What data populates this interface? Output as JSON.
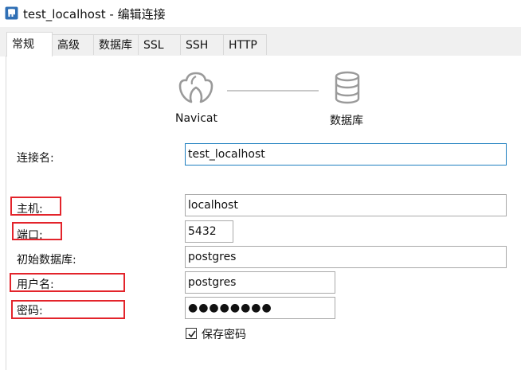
{
  "window": {
    "title": "test_localhost - 编辑连接",
    "icon": "elephant-app-icon"
  },
  "tabs": [
    {
      "label": "常规",
      "active": true
    },
    {
      "label": "高级",
      "active": false
    },
    {
      "label": "数据库",
      "active": false
    },
    {
      "label": "SSL",
      "active": false
    },
    {
      "label": "SSH",
      "active": false
    },
    {
      "label": "HTTP",
      "active": false
    }
  ],
  "graphic": {
    "left_caption": "Navicat",
    "right_caption": "数据库",
    "left_icon": "navicat-logo-icon",
    "right_icon": "database-icon"
  },
  "form": {
    "connection_name": {
      "label": "连接名:",
      "value": "test_localhost"
    },
    "host": {
      "label": "主机:",
      "value": "localhost"
    },
    "port": {
      "label": "端口:",
      "value": "5432"
    },
    "initial_db": {
      "label": "初始数据库:",
      "value": "postgres"
    },
    "username": {
      "label": "用户名:",
      "value": "postgres"
    },
    "password": {
      "label": "密码:",
      "value": "●●●●●●●●"
    },
    "save_password": {
      "label": "保存密码",
      "checked": true
    }
  },
  "colors": {
    "highlight_box": "#e3242b",
    "focus_border": "#1e7fbf"
  }
}
